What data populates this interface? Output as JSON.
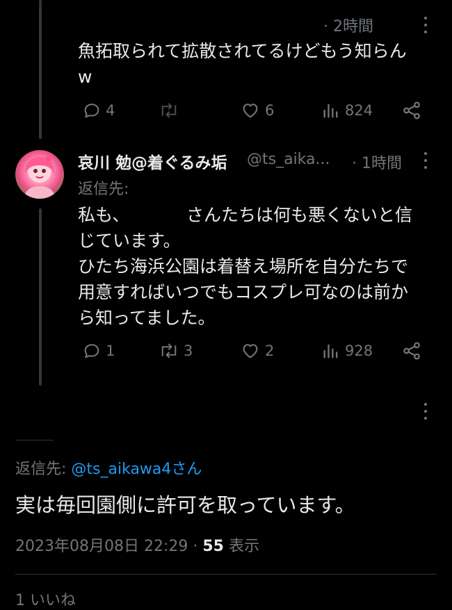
{
  "tweet1": {
    "time": "· 2時間",
    "text": "魚拓取られて拡散されてるけどもう知らん\nw",
    "replies": "4",
    "retweets": "",
    "likes": "6",
    "views": "824"
  },
  "tweet2": {
    "name": "哀川 勉@着ぐるみ垢",
    "handle": "@ts_aika...",
    "time": "· 1時間",
    "reply_label": "返信先:",
    "text_line1_a": "私も、",
    "text_line1_b": "さんたちは何も悪くないと信",
    "text_rest": "じています。\nひたち海浜公園は着替え場所を自分たちで\n用意すればいつでもコスプレ可なのは前か\nら知ってました。",
    "replies": "1",
    "retweets": "3",
    "likes": "2",
    "views": "928"
  },
  "main": {
    "reply_prefix": "返信先: ",
    "reply_handle": "@ts_aikawa4さん",
    "text": "実は毎回園側に許可を取っています。",
    "timestamp": "2023年08月08日 22:29 · ",
    "views_count": "55",
    "views_label": " 表示",
    "likes_partial": "1 いいね"
  },
  "icons": {
    "reply": "reply-icon",
    "retweet": "retweet-icon",
    "like": "heart-icon",
    "views": "views-icon",
    "share": "share-icon",
    "more": "more-icon"
  },
  "colors": {
    "background": "#000000",
    "text": "#e7e9ea",
    "muted": "#71767b",
    "link": "#1d9bf0",
    "thread_line": "#333639"
  }
}
